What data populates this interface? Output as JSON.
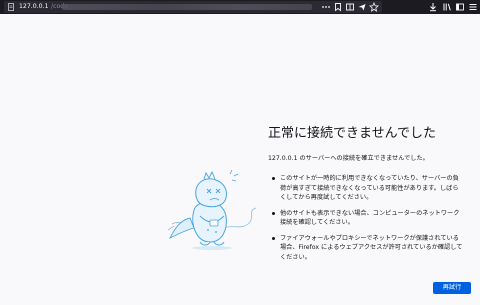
{
  "browser": {
    "url_host": "127.0.0.1",
    "url_path": "/code",
    "toolbar_icons": [
      "more-icon",
      "bookmark-icon",
      "reader-icon",
      "send-icon",
      "star-icon",
      "download-icon",
      "library-icon",
      "sidebar-icon",
      "menu-icon"
    ]
  },
  "error_page": {
    "title": "正常に接続できませんでした",
    "intro": "127.0.0.1 のサーバーへの接続を確立できませんでした。",
    "suggestions": [
      "このサイトが一時的に利用できなくなっていたり、サーバーの負荷が高すぎて接続できなくなっている可能性があります。しばらくしてから再度試してください。",
      "他のサイトも表示できない場合、コンピューターのネットワーク接続を確認してください。",
      "ファイアウォールやプロキシーでネットワークが保護されている場合、Firefox によるウェブアクセスが許可されているか確認してください。"
    ],
    "retry_label": "再試行",
    "illustration": "dinosaur-illustration"
  },
  "colors": {
    "toolbar": "#1c1b22",
    "urlbar": "#2b2a33",
    "page_bg": "#f9f9fb",
    "accent": "#0061e0",
    "illustration_blue": "#4aa3df"
  }
}
